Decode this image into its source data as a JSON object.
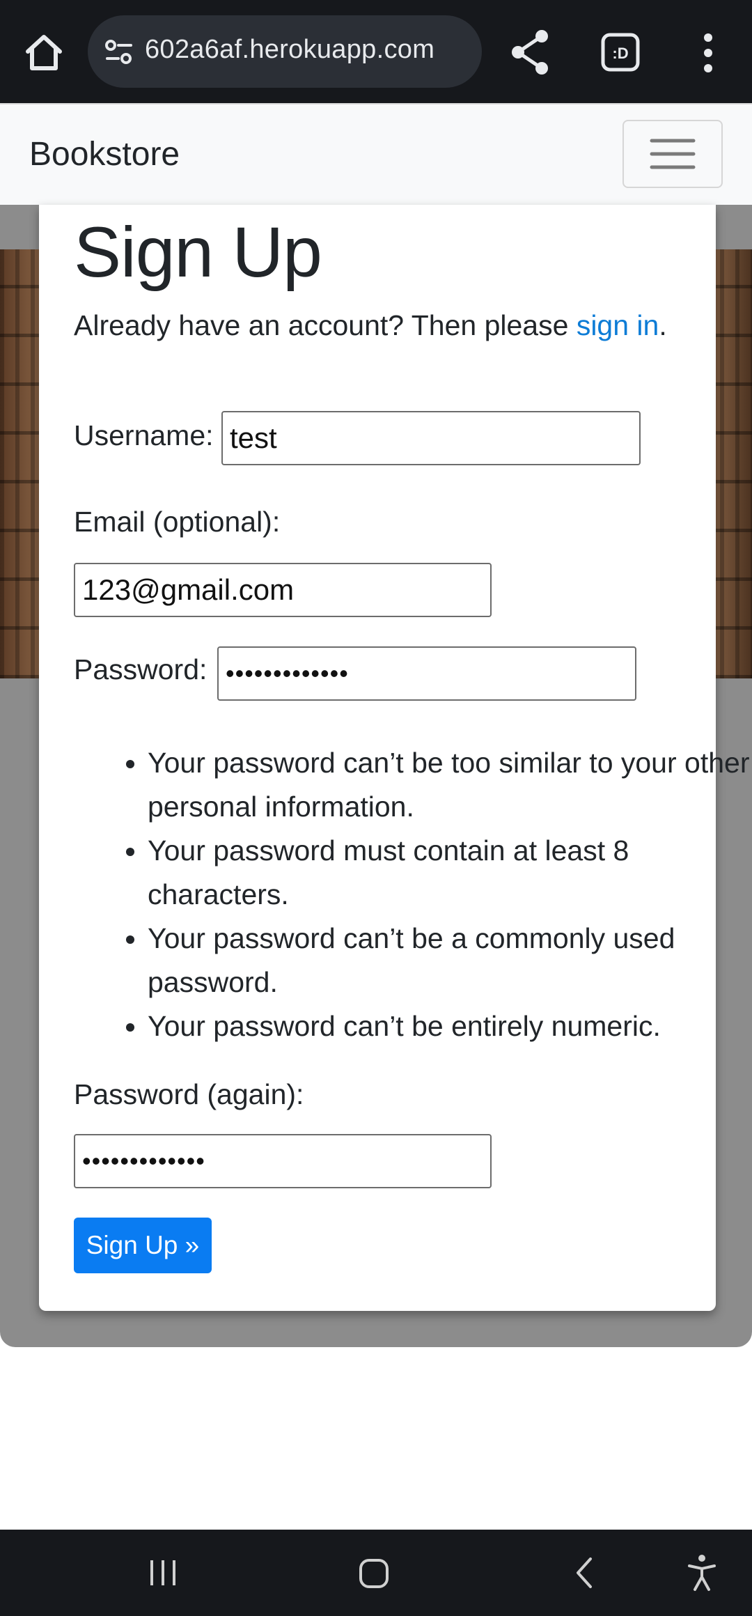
{
  "browser": {
    "url": "602a6af.herokuapp.com",
    "tabs_count": ":D"
  },
  "navbar": {
    "brand": "Bookstore"
  },
  "form": {
    "title": "Sign Up",
    "intro_text": "Already have an account? Then please ",
    "signin_link": "sign in",
    "intro_end": ".",
    "username_label": "Username:",
    "username_value": "test",
    "email_label": "Email (optional):",
    "email_value": "123@gmail.com",
    "password_label": "Password:",
    "password_value": "•••••••••••••",
    "rules": [
      "Your password can’t be too similar to your other personal information.",
      "Your password must contain at least 8 characters.",
      "Your password can’t be a commonly used password.",
      "Your password can’t be entirely numeric."
    ],
    "password2_label": "Password (again):",
    "password2_value": "•••••••••••••",
    "submit_label": "Sign Up »"
  },
  "colors": {
    "link": "#0d7cd6",
    "button": "#0a7cf2",
    "chrome": "#16181c"
  },
  "icons": [
    "home-icon",
    "site-settings-icon",
    "share-icon",
    "tabs-icon",
    "more-options-icon",
    "recent-apps-icon",
    "home-nav-icon",
    "back-icon",
    "accessibility-icon"
  ]
}
